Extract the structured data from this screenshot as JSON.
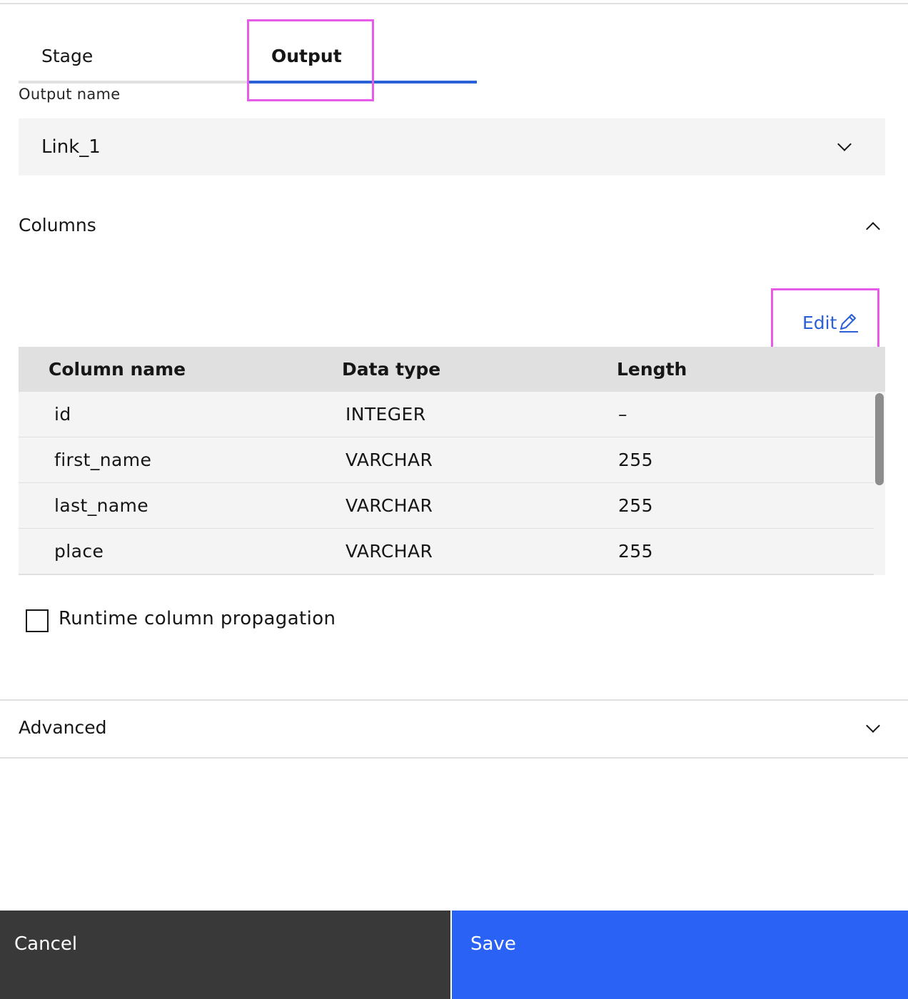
{
  "tabs": [
    {
      "label": "Stage",
      "active": false
    },
    {
      "label": "Output",
      "active": true
    }
  ],
  "output_name": {
    "label": "Output name",
    "value": "Link_1"
  },
  "columns_section": {
    "title": "Columns",
    "expanded": true,
    "edit_label": "Edit",
    "table": {
      "headers": [
        "Column name",
        "Data type",
        "Length"
      ],
      "rows": [
        {
          "name": "id",
          "type": "INTEGER",
          "length": "–"
        },
        {
          "name": "first_name",
          "type": "VARCHAR",
          "length": "255"
        },
        {
          "name": "last_name",
          "type": "VARCHAR",
          "length": "255"
        },
        {
          "name": "place",
          "type": "VARCHAR",
          "length": "255"
        }
      ]
    },
    "runtime_propagation": {
      "label": "Runtime column propagation",
      "checked": false
    }
  },
  "advanced_section": {
    "title": "Advanced",
    "expanded": false
  },
  "footer": {
    "cancel_label": "Cancel",
    "save_label": "Save"
  },
  "colors": {
    "accent": "#2a5fd6",
    "save_button": "#2a62f5",
    "cancel_button": "#393939",
    "highlight": "#e65be8"
  },
  "icons": {
    "select": "chevron-down-icon",
    "columns_toggle": "chevron-up-icon",
    "edit": "pencil-icon",
    "advanced_toggle": "chevron-down-icon"
  }
}
